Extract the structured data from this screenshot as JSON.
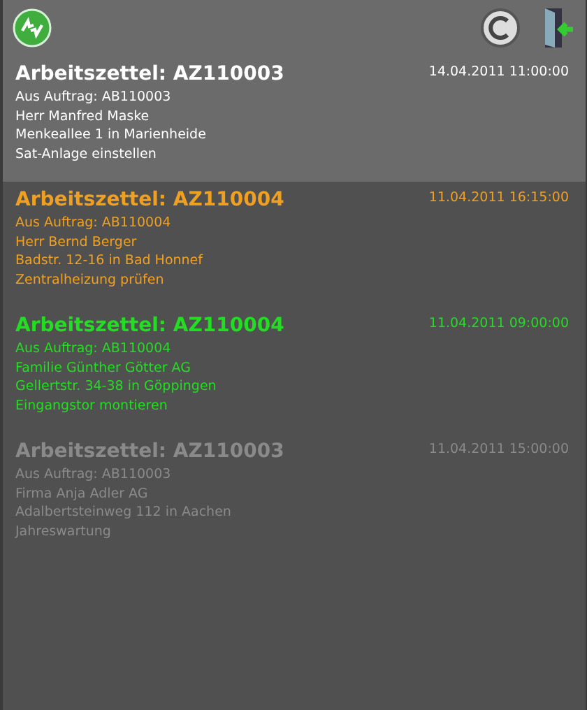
{
  "toolbar": {
    "buttons": [
      {
        "kind": "sync"
      },
      {
        "kind": "copyright"
      },
      {
        "kind": "exit"
      }
    ]
  },
  "worksheets": [
    {
      "title": "Arbeitszettel: AZ110003",
      "datetime": "14.04.2011 11:00:00",
      "lines": [
        "Aus Auftrag: AB110003",
        "Herr Manfred Maske",
        "Menkeallee 1 in Marienheide",
        "Sat-Anlage einstellen"
      ],
      "color": "#ffffff",
      "selected": true
    },
    {
      "title": "Arbeitszettel: AZ110004",
      "datetime": "11.04.2011 16:15:00",
      "lines": [
        "Aus Auftrag: AB110004",
        "Herr Bernd Berger",
        "Badstr. 12-16 in Bad Honnef",
        "Zentralheizung prüfen"
      ],
      "color": "#f0a020",
      "selected": false
    },
    {
      "title": "Arbeitszettel: AZ110004",
      "datetime": "11.04.2011 09:00:00",
      "lines": [
        "Aus Auftrag: AB110004",
        "Familie Günther Götter AG",
        "Gellertstr. 34-38 in Göppingen",
        "Eingangstor montieren"
      ],
      "color": "#22dd22",
      "selected": false
    },
    {
      "title": "Arbeitszettel: AZ110003",
      "datetime": "11.04.2011 15:00:00",
      "lines": [
        "Aus Auftrag: AB110003",
        "Firma Anja Adler AG",
        "Adalbertsteinweg 112 in Aachen",
        "Jahreswartung"
      ],
      "color": "#8a8a8a",
      "selected": false
    }
  ]
}
